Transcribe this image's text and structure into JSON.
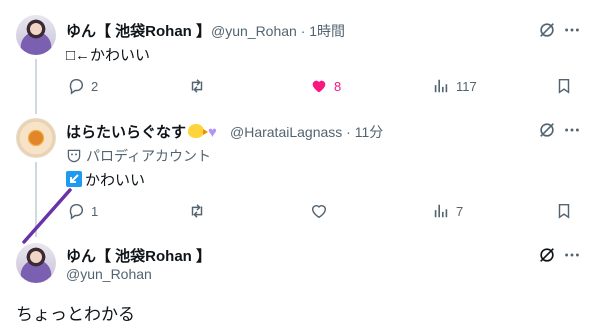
{
  "colors": {
    "like": "#f91880",
    "muted": "#536471",
    "line": "#cfd9de",
    "annotation": "#6a32a8"
  },
  "tweets": [
    {
      "name": "ゆん【 池袋Rohan 】",
      "handle_time": "@yun_Rohan · 1時間",
      "text": "□←かわいい",
      "actions": {
        "reply": "2",
        "retweet": "",
        "like": "8",
        "views": "117"
      }
    },
    {
      "name": "はらたいらぐなす",
      "handle_time": "@HarataiLagnass · 11分",
      "label": "パロディアカウント",
      "text": "かわいい",
      "actions": {
        "reply": "1",
        "retweet": "",
        "like": "",
        "views": "7"
      }
    }
  ],
  "compose": {
    "name": "ゆん【 池袋Rohan 】",
    "handle": "@yun_Rohan",
    "text": "ちょっとわかる"
  },
  "icons": [
    "grok-icon",
    "more-icon",
    "reply-icon",
    "retweet-icon",
    "heart-icon",
    "views-icon",
    "bookmark-icon",
    "parody-mask-icon",
    "arrow-icon"
  ]
}
